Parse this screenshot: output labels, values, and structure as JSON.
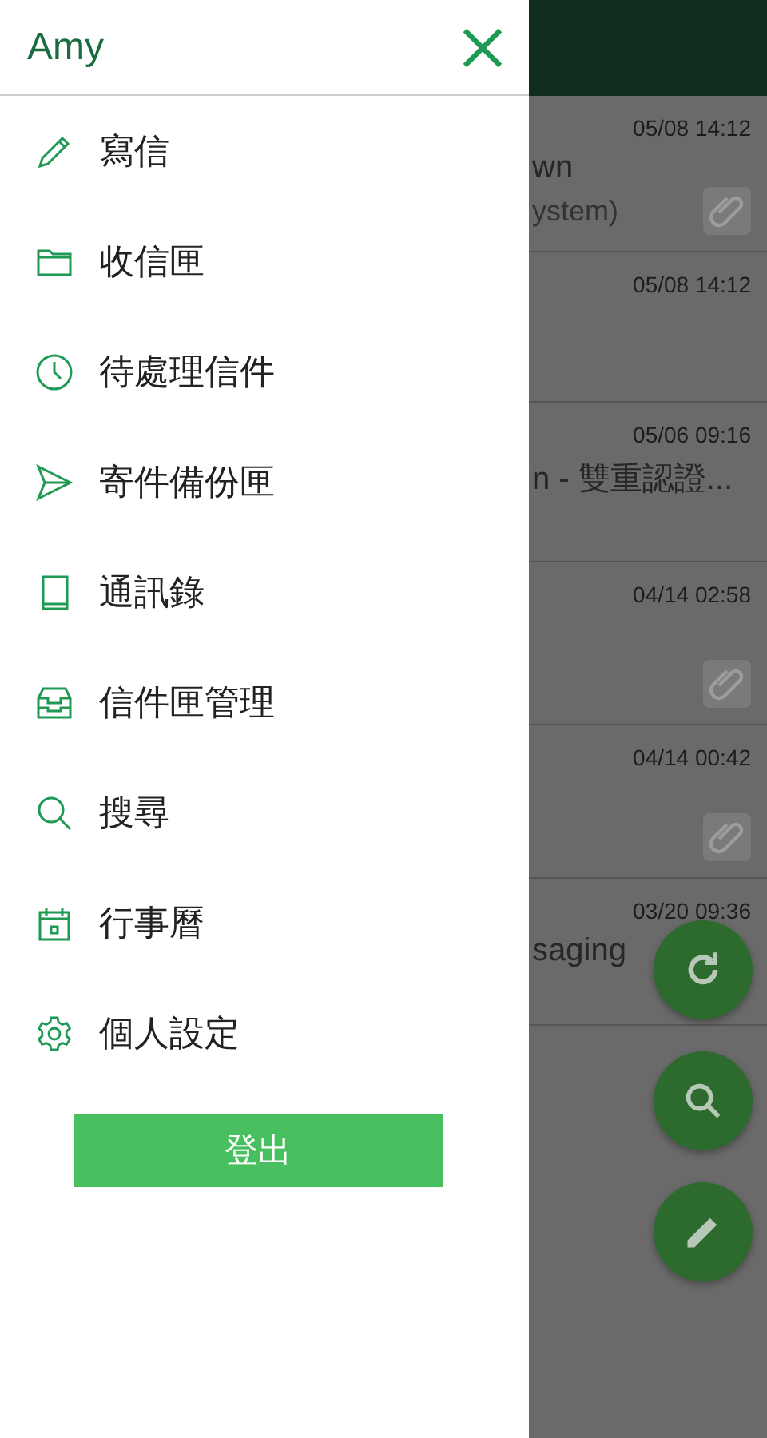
{
  "drawer": {
    "user": "Amy",
    "items": [
      {
        "kind": "pencil",
        "label": "寫信"
      },
      {
        "kind": "folder",
        "label": "收信匣"
      },
      {
        "kind": "clock",
        "label": "待處理信件"
      },
      {
        "kind": "send",
        "label": "寄件備份匣"
      },
      {
        "kind": "book",
        "label": "通訊錄"
      },
      {
        "kind": "tray",
        "label": "信件匣管理"
      },
      {
        "kind": "search",
        "label": "搜尋"
      },
      {
        "kind": "calendar",
        "label": "行事曆"
      },
      {
        "kind": "gear",
        "label": "個人設定"
      }
    ],
    "logout": "登出"
  },
  "messages": [
    {
      "time": "05/08 14:12",
      "subject": "wn",
      "sender": "ystem)",
      "attachment": true
    },
    {
      "time": "05/08 14:12",
      "attachment": false
    },
    {
      "time": "05/06 09:16",
      "subject": "n - 雙重認證...",
      "attachment": false
    },
    {
      "time": "04/14 02:58",
      "attachment": true
    },
    {
      "time": "04/14 00:42",
      "attachment": true
    },
    {
      "time": "03/20 09:36",
      "subject": "saging",
      "attachment": false
    }
  ],
  "fabs": [
    {
      "kind": "refresh"
    },
    {
      "kind": "search"
    },
    {
      "kind": "pencil"
    }
  ]
}
